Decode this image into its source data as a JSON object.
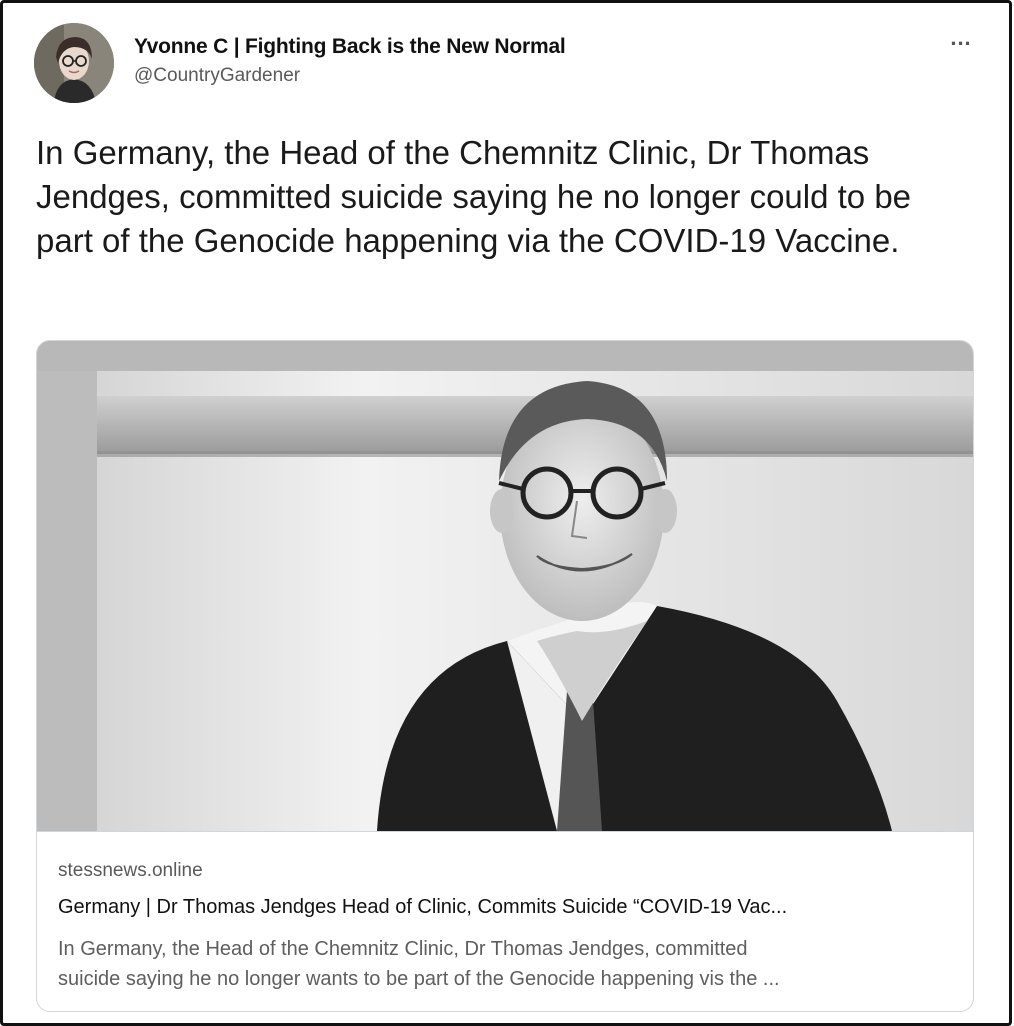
{
  "author": {
    "display_name": "Yvonne C | Fighting Back is the New Normal",
    "handle": "@CountryGardener",
    "avatar_icon": "avatar-photo"
  },
  "menu": {
    "more_label": "..."
  },
  "tweet": {
    "text": "In Germany, the Head of the Chemnitz Clinic, Dr Thomas Jendges, committed suicide saying he no longer could to be part of the Genocide happening via the COVID-19 Vaccine."
  },
  "link_card": {
    "domain": "stessnews.online",
    "title": "Germany | Dr Thomas Jendges Head of Clinic, Commits Suicide “COVID-19 Vac...",
    "description_line1": "In Germany, the Head of the Chemnitz Clinic, Dr Thomas Jendges, committed",
    "description_line2": "suicide saying he no longer wants to be part of the Genocide happening vis the ..."
  },
  "colors": {
    "border": "#cfd6dc",
    "text_primary": "#111111",
    "text_secondary": "#5a5a5a"
  }
}
